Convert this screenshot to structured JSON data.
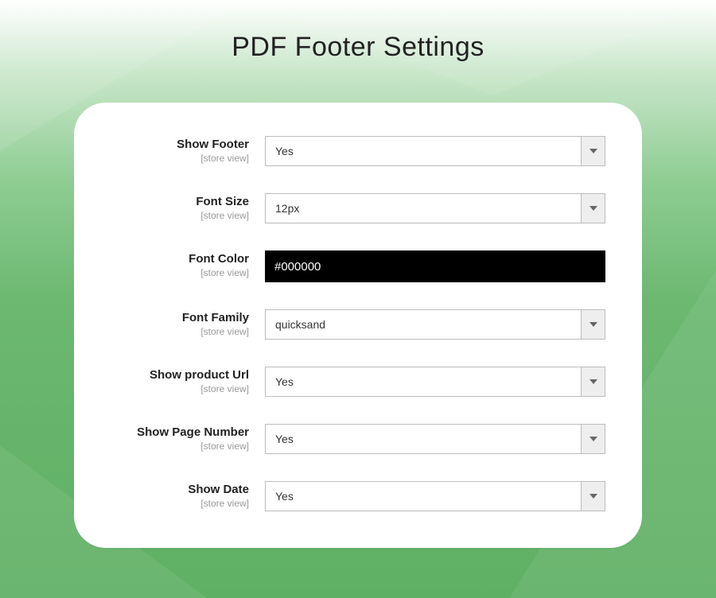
{
  "title": "PDF Footer Settings",
  "scope_label": "[store view]",
  "fields": {
    "show_footer": {
      "label": "Show Footer",
      "value": "Yes",
      "type": "select"
    },
    "font_size": {
      "label": "Font Size",
      "value": "12px",
      "type": "select"
    },
    "font_color": {
      "label": "Font Color",
      "value": "#000000",
      "type": "color",
      "bg": "#000000",
      "fg": "#ffffff"
    },
    "font_family": {
      "label": "Font Family",
      "value": "quicksand",
      "type": "select"
    },
    "show_product_url": {
      "label": "Show product Url",
      "value": "Yes",
      "type": "select"
    },
    "show_page_number": {
      "label": "Show Page Number",
      "value": "Yes",
      "type": "select"
    },
    "show_date": {
      "label": "Show Date",
      "value": "Yes",
      "type": "select"
    }
  }
}
